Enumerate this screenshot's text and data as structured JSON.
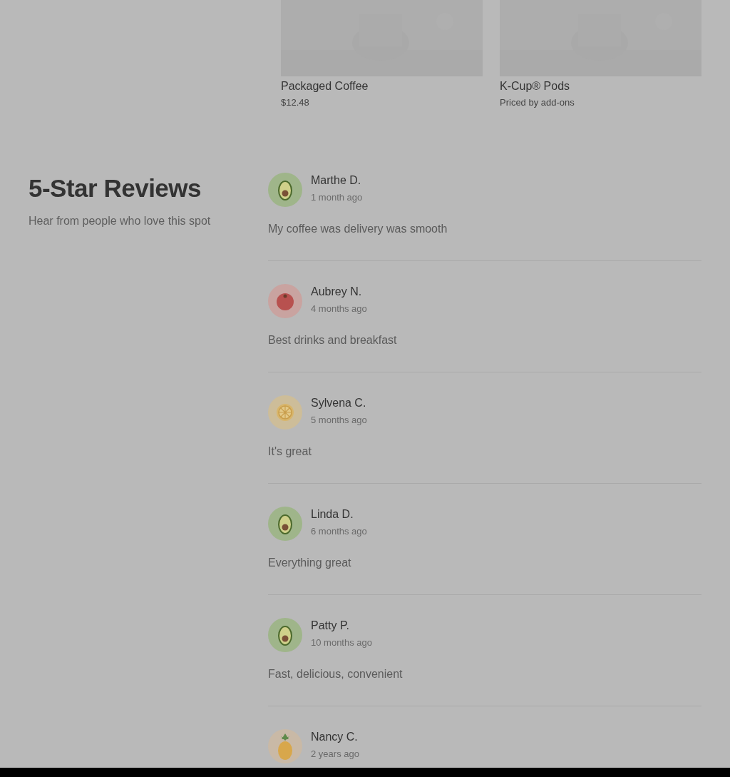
{
  "products": [
    {
      "name": "Packaged Coffee",
      "price": "$12.48"
    },
    {
      "name": "K-Cup® Pods",
      "price": "Priced by add-ons"
    }
  ],
  "reviews_section": {
    "title": "5-Star Reviews",
    "subtitle": "Hear from people who love this spot"
  },
  "reviews": [
    {
      "name": "Marthe D.",
      "time": "1 month ago",
      "text": "My coffee was delivery was smooth",
      "avatar": {
        "kind": "avocado"
      }
    },
    {
      "name": "Aubrey N.",
      "time": "4 months ago",
      "text": "Best drinks and breakfast",
      "avatar": {
        "kind": "tomato"
      }
    },
    {
      "name": "Sylvena C.",
      "time": "5 months ago",
      "text": "It's great",
      "avatar": {
        "kind": "lemon"
      }
    },
    {
      "name": "Linda D.",
      "time": "6 months ago",
      "text": "Everything great",
      "avatar": {
        "kind": "avocado"
      }
    },
    {
      "name": "Patty P.",
      "time": "10 months ago",
      "text": "Fast, delicious, convenient",
      "avatar": {
        "kind": "avocado"
      }
    },
    {
      "name": "Nancy C.",
      "time": "2 years ago",
      "avatar": {
        "kind": "pineapple"
      }
    }
  ]
}
